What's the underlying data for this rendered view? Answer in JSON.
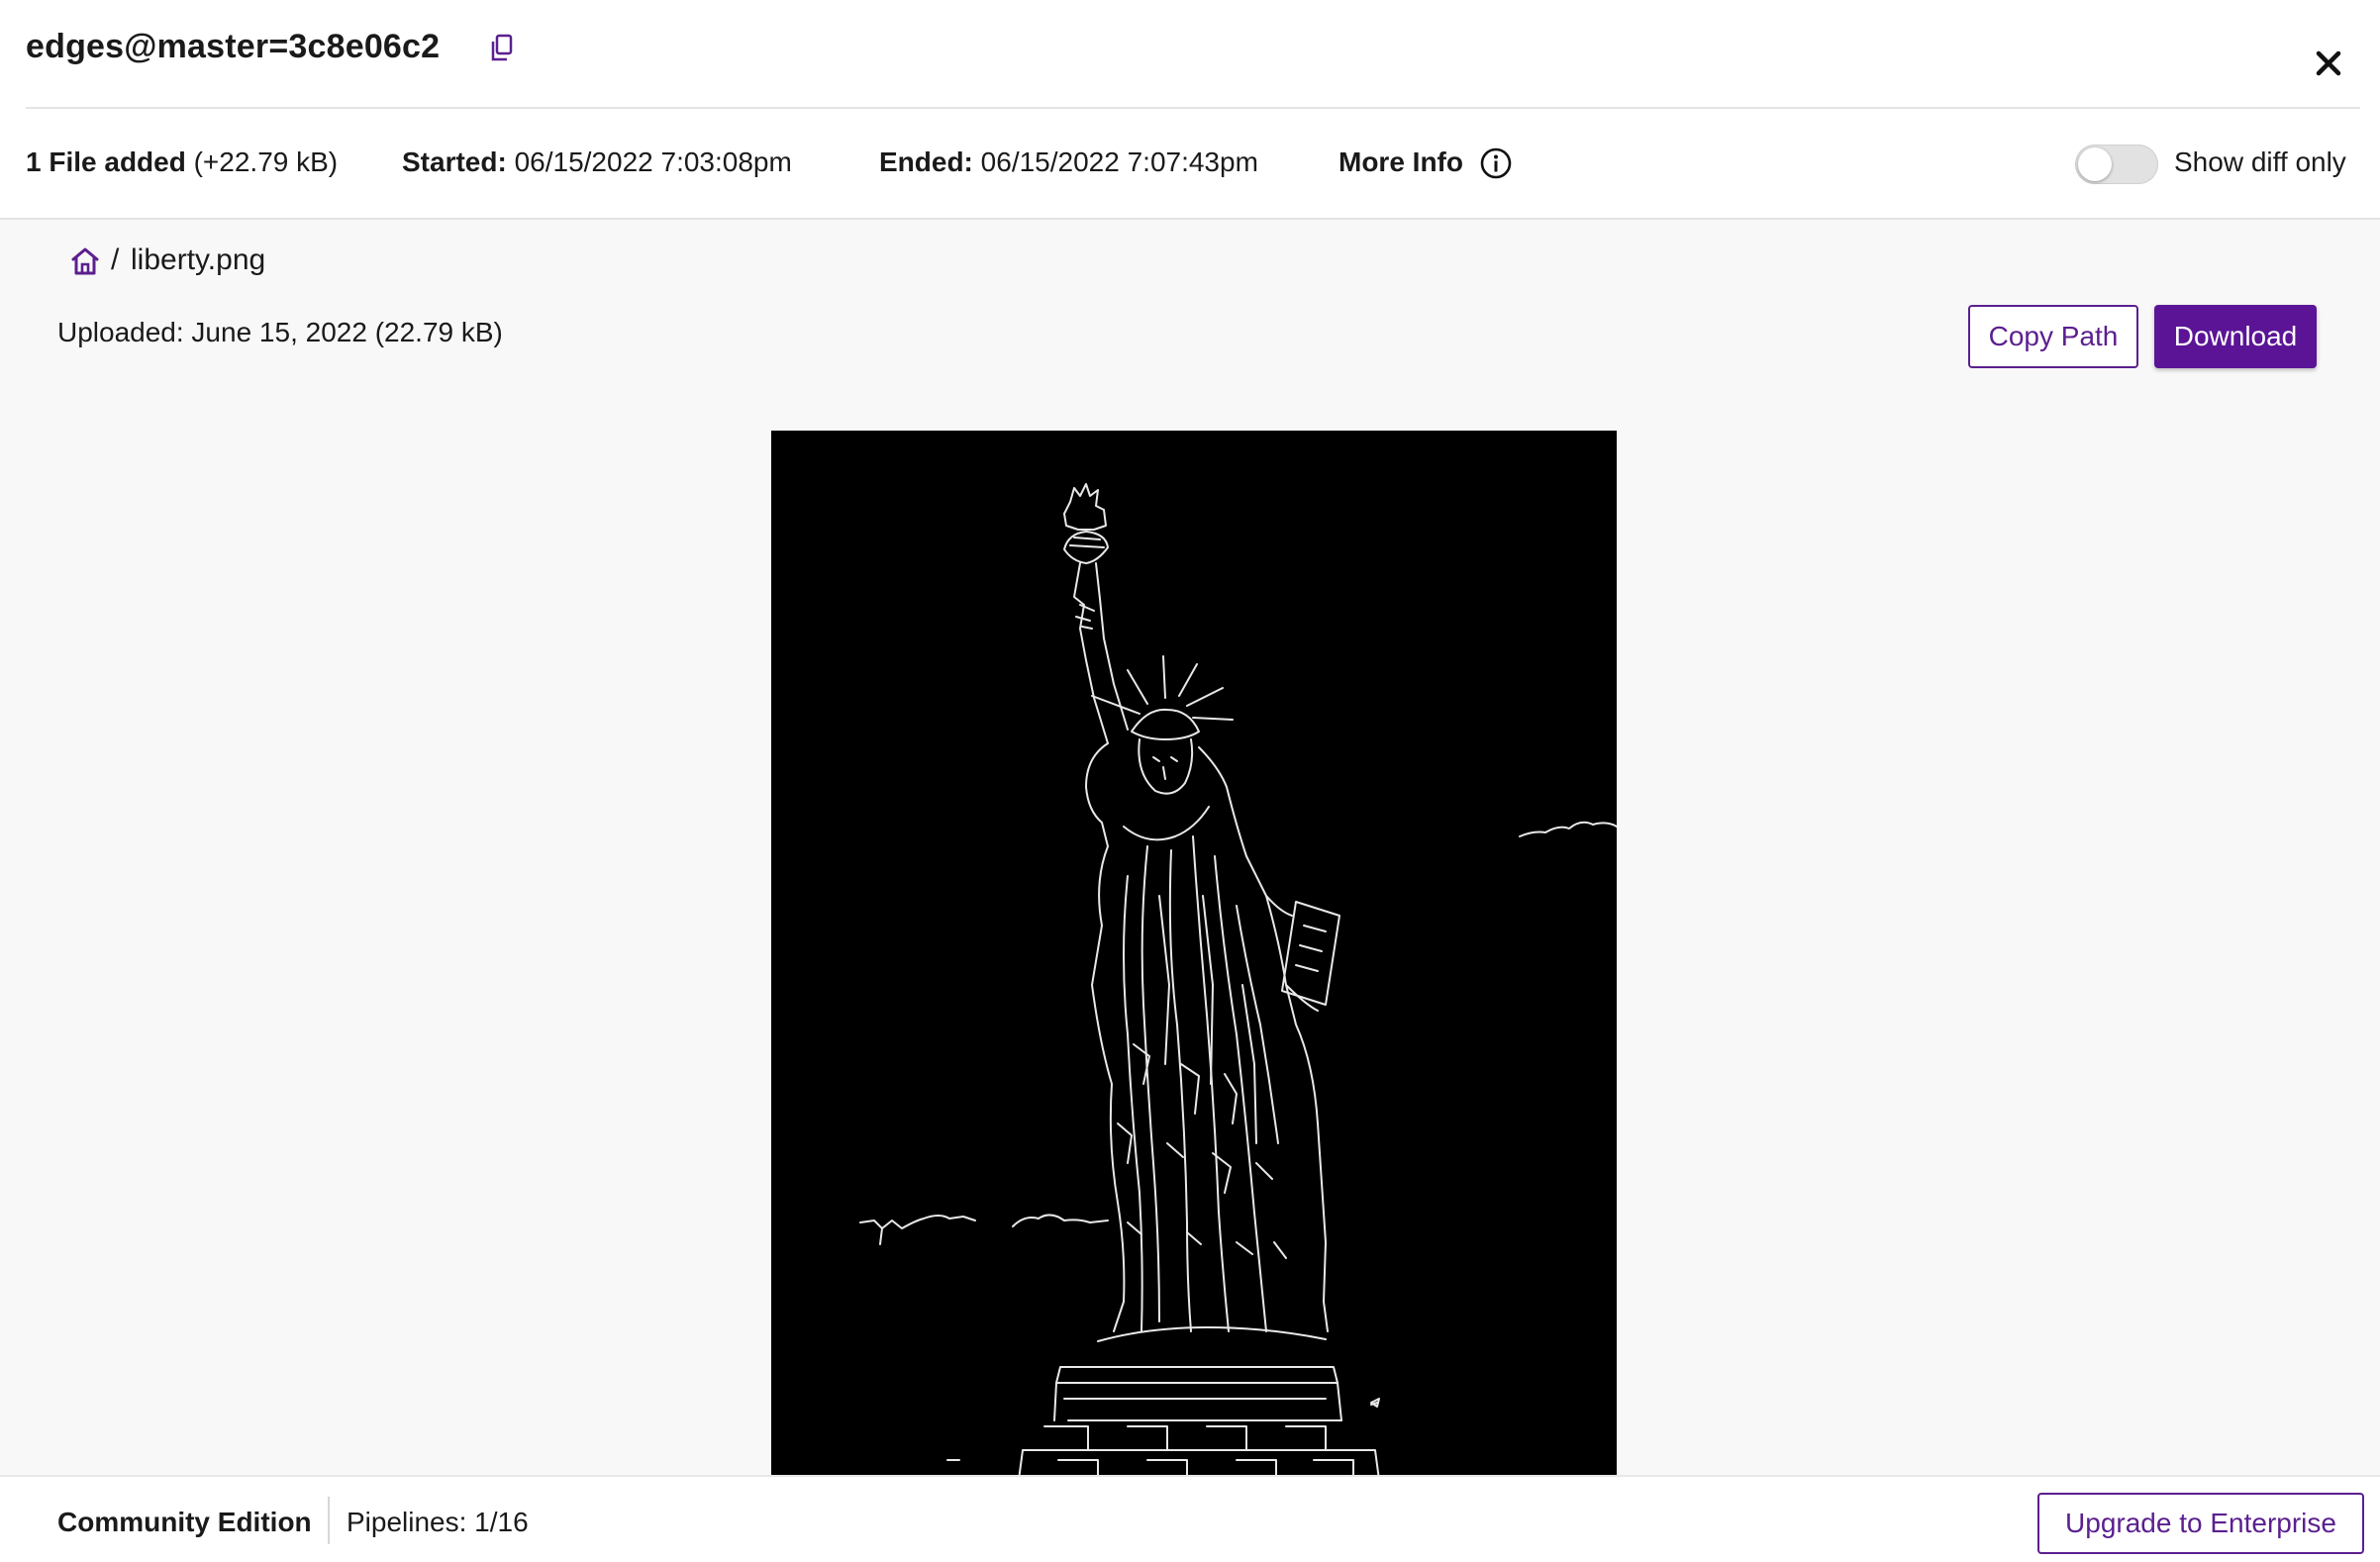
{
  "header": {
    "title": "edges@master=3c8e06c2",
    "copy_icon": "copy-icon",
    "close_icon": "close-icon"
  },
  "info": {
    "files_added_label": "1 File added",
    "files_added_size": "(+22.79 kB)",
    "started_label": "Started:",
    "started_value": "06/15/2022 7:03:08pm",
    "ended_label": "Ended:",
    "ended_value": "06/15/2022 7:07:43pm",
    "more_info_label": "More Info",
    "info_icon": "info-icon",
    "show_diff_label": "Show diff only",
    "show_diff_enabled": false
  },
  "file": {
    "home_icon": "home-icon",
    "separator": "/",
    "name": "liberty.png",
    "uploaded_text": "Uploaded: June 15, 2022 (22.79 kB)",
    "copy_path_label": "Copy Path",
    "download_label": "Download",
    "preview_alt": "liberty.png"
  },
  "footer": {
    "edition": "Community Edition",
    "pipelines": "Pipelines: 1/16",
    "upgrade_label": "Upgrade to Enterprise"
  },
  "colors": {
    "accent": "#5b1496",
    "accent_border": "#5b1f8f",
    "content_bg": "#f8f8f8",
    "divider": "#e4e4e4"
  }
}
